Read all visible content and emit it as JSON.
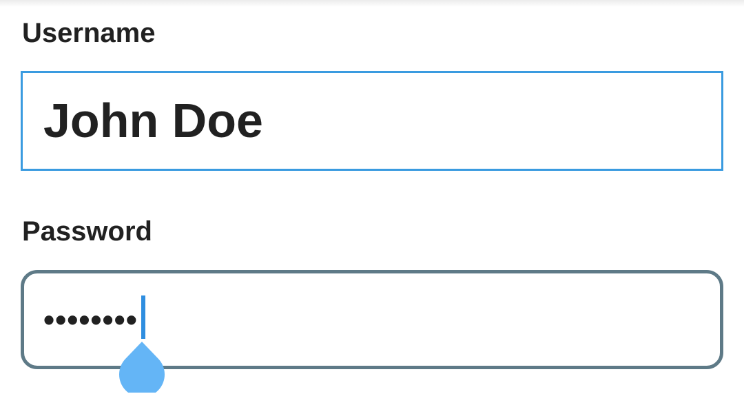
{
  "form": {
    "username": {
      "label": "Username",
      "value": "John Doe"
    },
    "password": {
      "label": "Password",
      "masked_value": "••••••••"
    }
  },
  "colors": {
    "focus_border": "#3a9be0",
    "field_border": "#5e7a87",
    "caret": "#2f8ee0",
    "caret_handle": "#64b5f6",
    "text": "#212121"
  }
}
